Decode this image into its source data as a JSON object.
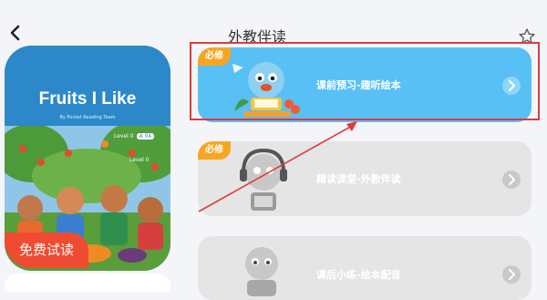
{
  "header": {
    "title": "外教伴读"
  },
  "book": {
    "title": "Fruits I Like",
    "author_line": "By Pocket Reading Team",
    "level_label": "Level 0",
    "level_code": "A 04",
    "level_sub": "Level 0",
    "publisher_name": "Pocket Reading",
    "publisher_level": "Level 0 A"
  },
  "trial_button": {
    "label": "免费试读"
  },
  "lessons": [
    {
      "badge": "必修",
      "label": "课前预习-趣听绘本",
      "state": "active"
    },
    {
      "badge": "必修",
      "label": "精读课堂-外教伴读",
      "state": "locked"
    },
    {
      "badge": "",
      "label": "课后小练-绘本配音",
      "state": "locked"
    }
  ],
  "colors": {
    "accent": "#59c0f5",
    "badge": "#f8a621",
    "trial": "#ef4b33",
    "highlight": "#e03a3a",
    "locked": "#e5e5e5"
  },
  "icons": [
    "back-arrow-icon",
    "star-icon",
    "chevron-right-icon"
  ]
}
